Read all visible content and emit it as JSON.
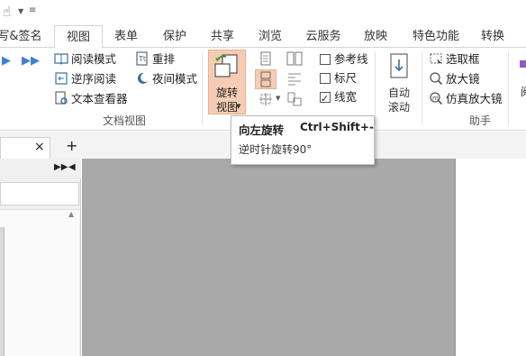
{
  "quick_access": {
    "hand_icon": "hand-tool-icon"
  },
  "tabs": [
    {
      "label": "写&签名"
    },
    {
      "label": "视图"
    },
    {
      "label": "表单"
    },
    {
      "label": "保护"
    },
    {
      "label": "共享"
    },
    {
      "label": "浏览"
    },
    {
      "label": "云服务"
    },
    {
      "label": "放映"
    },
    {
      "label": "特色功能"
    },
    {
      "label": "转换"
    }
  ],
  "ribbon": {
    "doc_view": {
      "read_mode": "阅读模式",
      "reverse_read": "逆序阅读",
      "text_viewer": "文本查看器",
      "reflow": "重排",
      "night_mode": "夜间模式",
      "group_label": "文档视图"
    },
    "rotate": {
      "label_line1": "旋转",
      "label_line2": "视图"
    },
    "show": {
      "guides": "参考线",
      "ruler": "标尺",
      "line_width": "线宽"
    },
    "auto_scroll": {
      "line1": "自动",
      "line2": "滚动"
    },
    "assistant": {
      "select_box": "选取框",
      "magnifier": "放大镜",
      "loupe": "仿真放大镜",
      "group_label": "助手"
    },
    "truncated_label": "阅"
  },
  "tooltip": {
    "title": "向左旋转",
    "shortcut": "Ctrl+Shift+-",
    "description": "逆时针旋转90°"
  },
  "doc_tabs": {
    "close": "×",
    "add": "+"
  },
  "colors": {
    "accent": "#3d7fd4",
    "rotate_highlight": "#f6cdb4",
    "viewer_bg": "#a9a9a9"
  }
}
